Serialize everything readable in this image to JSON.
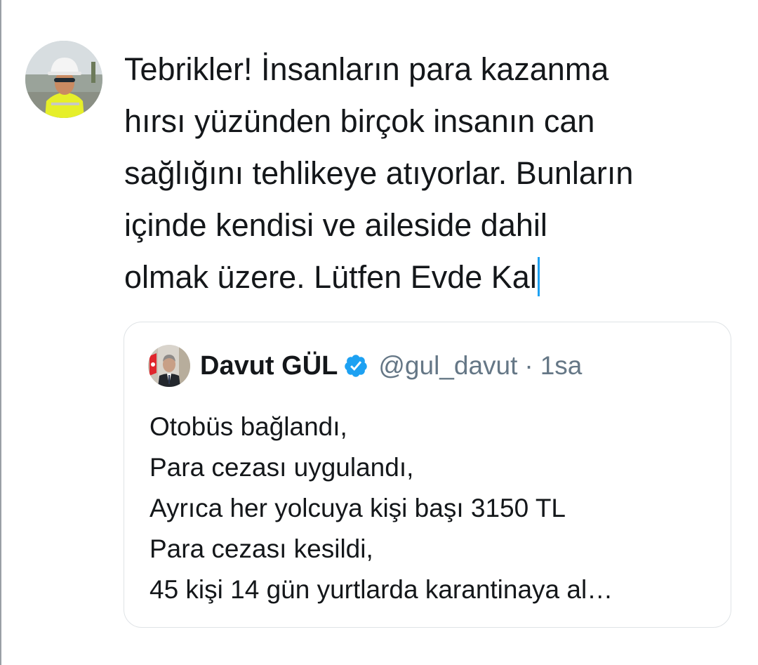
{
  "compose": {
    "text": "Tebrikler! İnsanların para kazanma\nhırsı yüzünden birçok insanın can\nsağlığını tehlikeye atıyorlar. Bunların\niçinde kendisi ve aileside dahil\nolmak üzere. Lütfen Evde Kal",
    "caret_color": "#1da1f2"
  },
  "user_avatar": {
    "icon": "profile-photo-worker-hardhat"
  },
  "quoted_tweet": {
    "author_name": "Davut GÜL",
    "verified_icon": "verified-badge-icon",
    "handle": "@gul_davut",
    "separator": "·",
    "time": "1sa",
    "lines": [
      "Otobüs bağlandı,",
      "Para cezası uygulandı,",
      "Ayrıca her yolcuya kişi başı 3150 TL",
      "Para cezası kesildi,",
      "45 kişi 14 gün yurtlarda karantinaya al…"
    ]
  },
  "colors": {
    "text": "#14171a",
    "secondary": "#657786",
    "accent": "#1da1f2",
    "border": "#dfe3e6"
  }
}
